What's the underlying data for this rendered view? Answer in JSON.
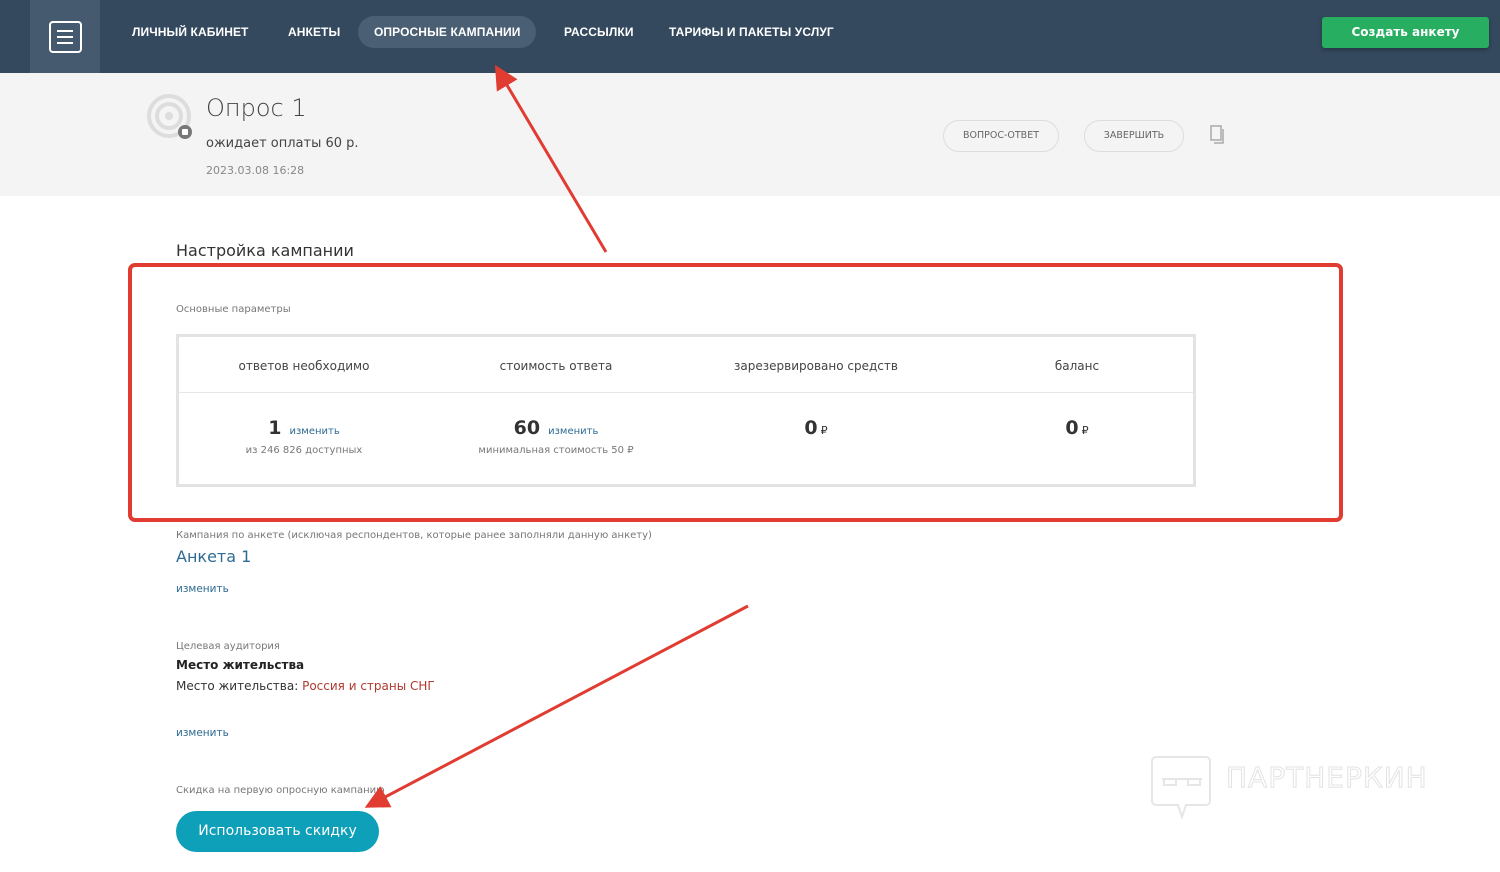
{
  "nav": {
    "items": [
      "ЛИЧНЫЙ КАБИНЕТ",
      "АНКЕТЫ",
      "ОПРОСНЫЕ КАМПАНИИ",
      "РАССЫЛКИ",
      "ТАРИФЫ И ПАКЕТЫ УСЛУГ"
    ],
    "active": "ОПРОСНЫЕ КАМПАНИИ",
    "create_button": "Создать анкету"
  },
  "survey": {
    "title": "Опрос 1",
    "status": "ожидает оплаты 60 р.",
    "date": "2023.03.08 16:28",
    "buttons": [
      "ВОПРОС-ОТВЕТ",
      "ЗАВЕРШИТЬ"
    ]
  },
  "settings": {
    "heading": "Настройка кампании",
    "basic_label": "Основные параметры",
    "columns": [
      "ответов необходимо",
      "стоимость ответа",
      "зарезервировано средств",
      "баланс"
    ],
    "answers": {
      "value": "1",
      "link": "изменить",
      "sub": "из 246 826 доступных"
    },
    "cost": {
      "value": "60",
      "link": "изменить",
      "sub": "минимальная стоимость 50 ₽"
    },
    "reserved": {
      "value": "0",
      "currency": "₽"
    },
    "balance": {
      "value": "0",
      "currency": "₽"
    }
  },
  "campaign": {
    "label": "Кампания по анкете (исключая респондентов, которые ранее заполняли данную анкету)",
    "form_name": "Анкета 1",
    "change_link": "изменить"
  },
  "audience": {
    "label": "Целевая аудитория",
    "heading": "Место жительства",
    "line_label": "Место жительства:",
    "line_value": "Россия и страны СНГ",
    "change_link": "изменить"
  },
  "discount": {
    "label": "Скидка на первую опросную кампанию",
    "button": "Использовать скидку"
  },
  "watermark": "ПАРТНЕРКИН",
  "colors": {
    "nav": "#34495e",
    "create": "#27ae60",
    "discount": "#0e9fb9",
    "link": "#2e6b93",
    "annotation": "#e03c31"
  }
}
